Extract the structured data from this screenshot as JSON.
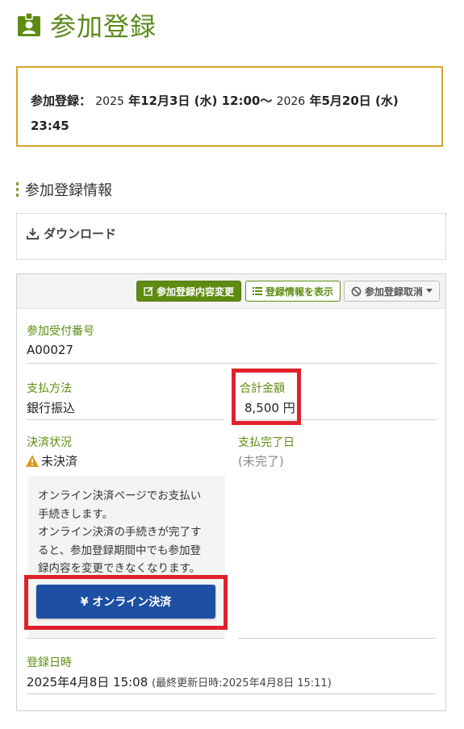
{
  "page": {
    "title": "参加登録",
    "icon": "badge-icon",
    "accent": "#5e8c12"
  },
  "period": {
    "label": "参加登録：",
    "start_year": "2025",
    "start_rest": "年12月3日 (水) 12:00〜",
    "end_year": "2026",
    "end_rest": "年5月20日 (水)",
    "end_time": "23:45"
  },
  "section": {
    "heading": "参加登録情報"
  },
  "download": {
    "label": "ダウンロード",
    "icon": "download-icon"
  },
  "toolbar": {
    "edit_label": "参加登録内容変更",
    "view_label": "登録情報を表示",
    "cancel_label": "参加登録取消"
  },
  "fields": {
    "receipt_label": "参加受付番号",
    "receipt_value": "A00027",
    "payment_method_label": "支払方法",
    "payment_method_value": "銀行振込",
    "total_label": "合計金額",
    "total_value": "8,500 円",
    "status_label": "決済状況",
    "status_value": "未決済",
    "paid_date_label": "支払完了日",
    "paid_date_value": "(未完了)",
    "registered_label": "登録日時",
    "registered_value": "2025年4月8日 15:08",
    "updated_value": "(最終更新日時:2025年4月8日 15:11)"
  },
  "notice": {
    "line1": "オンライン決済ページでお支払い",
    "line2": "手続きします。",
    "line3": "オンライン決済の手続きが完了す",
    "line4": "ると、参加登録期間中でも参加登",
    "line5": "録内容を変更できなくなります。",
    "pay_button_label": "¥ オンライン決済"
  },
  "colors": {
    "highlight": "#e0212b",
    "pay_button": "#1d4fa3",
    "period_border": "#d4a62a"
  }
}
